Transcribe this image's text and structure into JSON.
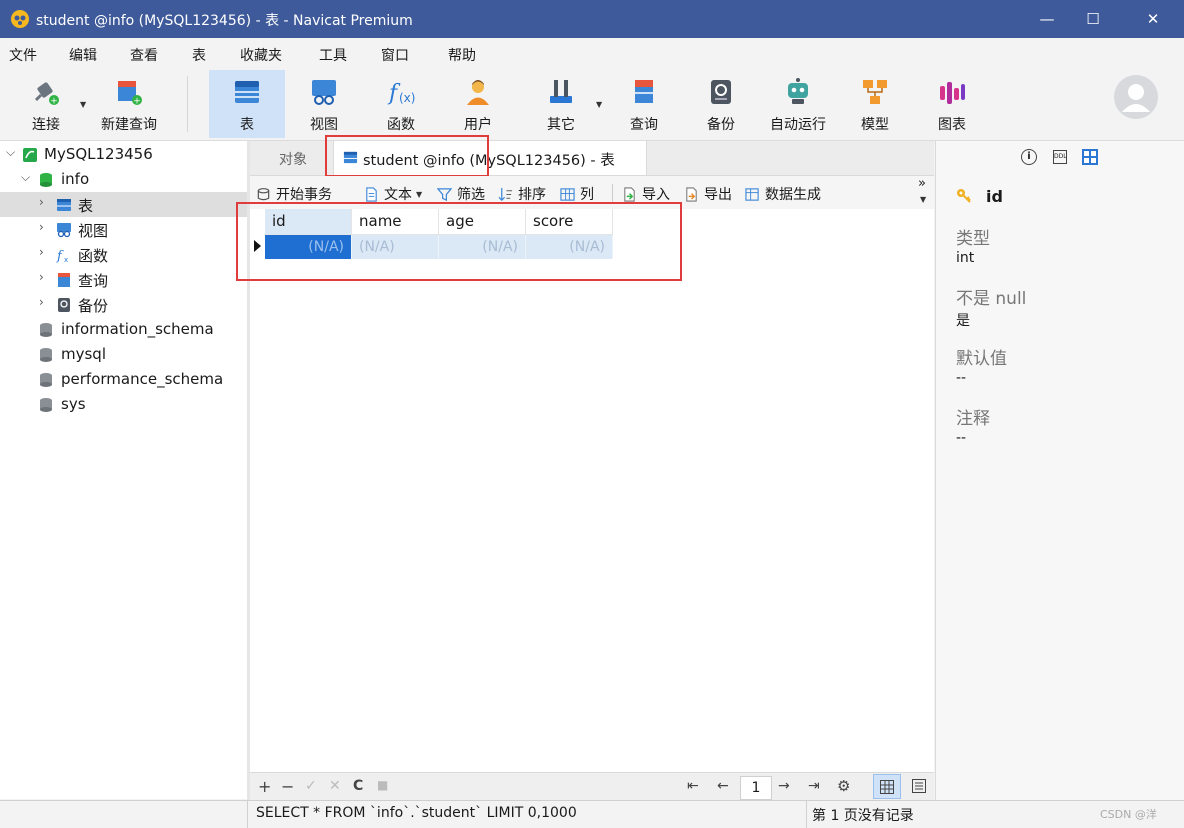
{
  "window": {
    "title": "student @info (MySQL123456) - 表 - Navicat Premium",
    "minimize_glyph": "—",
    "maximize_glyph": "☐",
    "close_glyph": "✕"
  },
  "menu": [
    "文件",
    "编辑",
    "查看",
    "表",
    "收藏夹",
    "工具",
    "窗口",
    "帮助"
  ],
  "toolbar": {
    "connect": "连接",
    "new_query": "新建查询",
    "table": "表",
    "view": "视图",
    "function": "函数",
    "user": "用户",
    "other": "其它",
    "query": "查询",
    "backup": "备份",
    "automation": "自动运行",
    "model": "模型",
    "chart": "图表"
  },
  "tree": {
    "connection": "MySQL123456",
    "database": "info",
    "items": [
      "表",
      "视图",
      "函数",
      "查询",
      "备份"
    ],
    "other_dbs": [
      "information_schema",
      "mysql",
      "performance_schema",
      "sys"
    ]
  },
  "tabs": {
    "objects": "对象",
    "active": "student @info (MySQL123456) - 表"
  },
  "subtoolbar": {
    "begin_tx": "开始事务",
    "text": "文本",
    "filter": "筛选",
    "sort": "排序",
    "columns": "列",
    "import": "导入",
    "export": "导出",
    "data_gen": "数据生成",
    "more": "»"
  },
  "grid": {
    "columns": [
      "id",
      "name",
      "age",
      "score"
    ],
    "row": [
      "(N/A)",
      "(N/A)",
      "(N/A)",
      "(N/A)"
    ]
  },
  "bottombar": {
    "add": "+",
    "remove": "−",
    "apply": "✓",
    "discard": "✕",
    "refresh": "C",
    "stop": "■",
    "first": "⇤",
    "prev": "←",
    "page": "1",
    "next": "→",
    "last": "⇥",
    "settings": "⚙"
  },
  "status": {
    "sql": "SELECT * FROM `info`.`student` LIMIT 0,1000",
    "page_info": "第 1 页没有记录",
    "watermark": "CSDN @洋 "
  },
  "inspector": {
    "field_name": "id",
    "type_label": "类型",
    "type_value": "int",
    "notnull_label": "不是 null",
    "notnull_value": "是",
    "default_label": "默认值",
    "default_value": "--",
    "comment_label": "注释",
    "comment_value": "--"
  },
  "colors": {
    "titlebar": "#3e5a9a",
    "highlight_box": "#e03c3c",
    "selected_cell": "#1e6fd1"
  }
}
